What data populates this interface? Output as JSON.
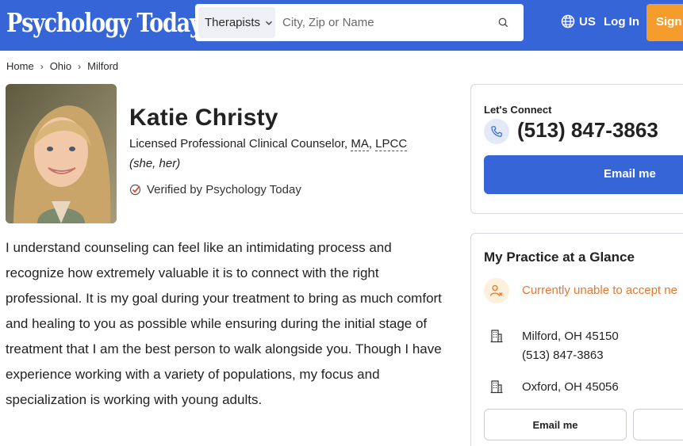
{
  "header": {
    "logo": "Psychology Today",
    "search_category": "Therapists",
    "search_placeholder": "City, Zip or Name",
    "region": "US",
    "login": "Log In",
    "signup": "Sign"
  },
  "breadcrumb": [
    "Home",
    "Ohio",
    "Milford"
  ],
  "profile": {
    "name": "Katie Christy",
    "title_prefix": "Licensed Professional Clinical Counselor, ",
    "degree_1": "MA",
    "degree_sep": ", ",
    "degree_2": "LPCC",
    "pronouns": "(she, her)",
    "verified": "Verified by Psychology Today",
    "bio": "I understand counseling can feel like an intimidating process and recognize how extremely valuable it is to connect with the right professional. It is my goal during your treatment to bring as much comfort and healing to you as possible while ensuring during the initial stage of treatment that I am the best person to walk alongside you. Though I have experience working with a variety of populations, my focus and specialization is working with young adults."
  },
  "connect": {
    "label": "Let's Connect",
    "phone": "(513) 847-3863",
    "email_button": "Email me"
  },
  "glance": {
    "title": "My Practice at a Glance",
    "status": "Currently unable to accept ne",
    "locations": [
      {
        "line1": "Milford, OH 45150",
        "line2": "(513) 847-3863"
      },
      {
        "line1": "Oxford, OH 45056"
      }
    ],
    "email_button": "Email me"
  },
  "colors": {
    "brand_blue": "#3565d6",
    "signup_orange": "#f59d2c",
    "status_orange": "#e7782e"
  }
}
